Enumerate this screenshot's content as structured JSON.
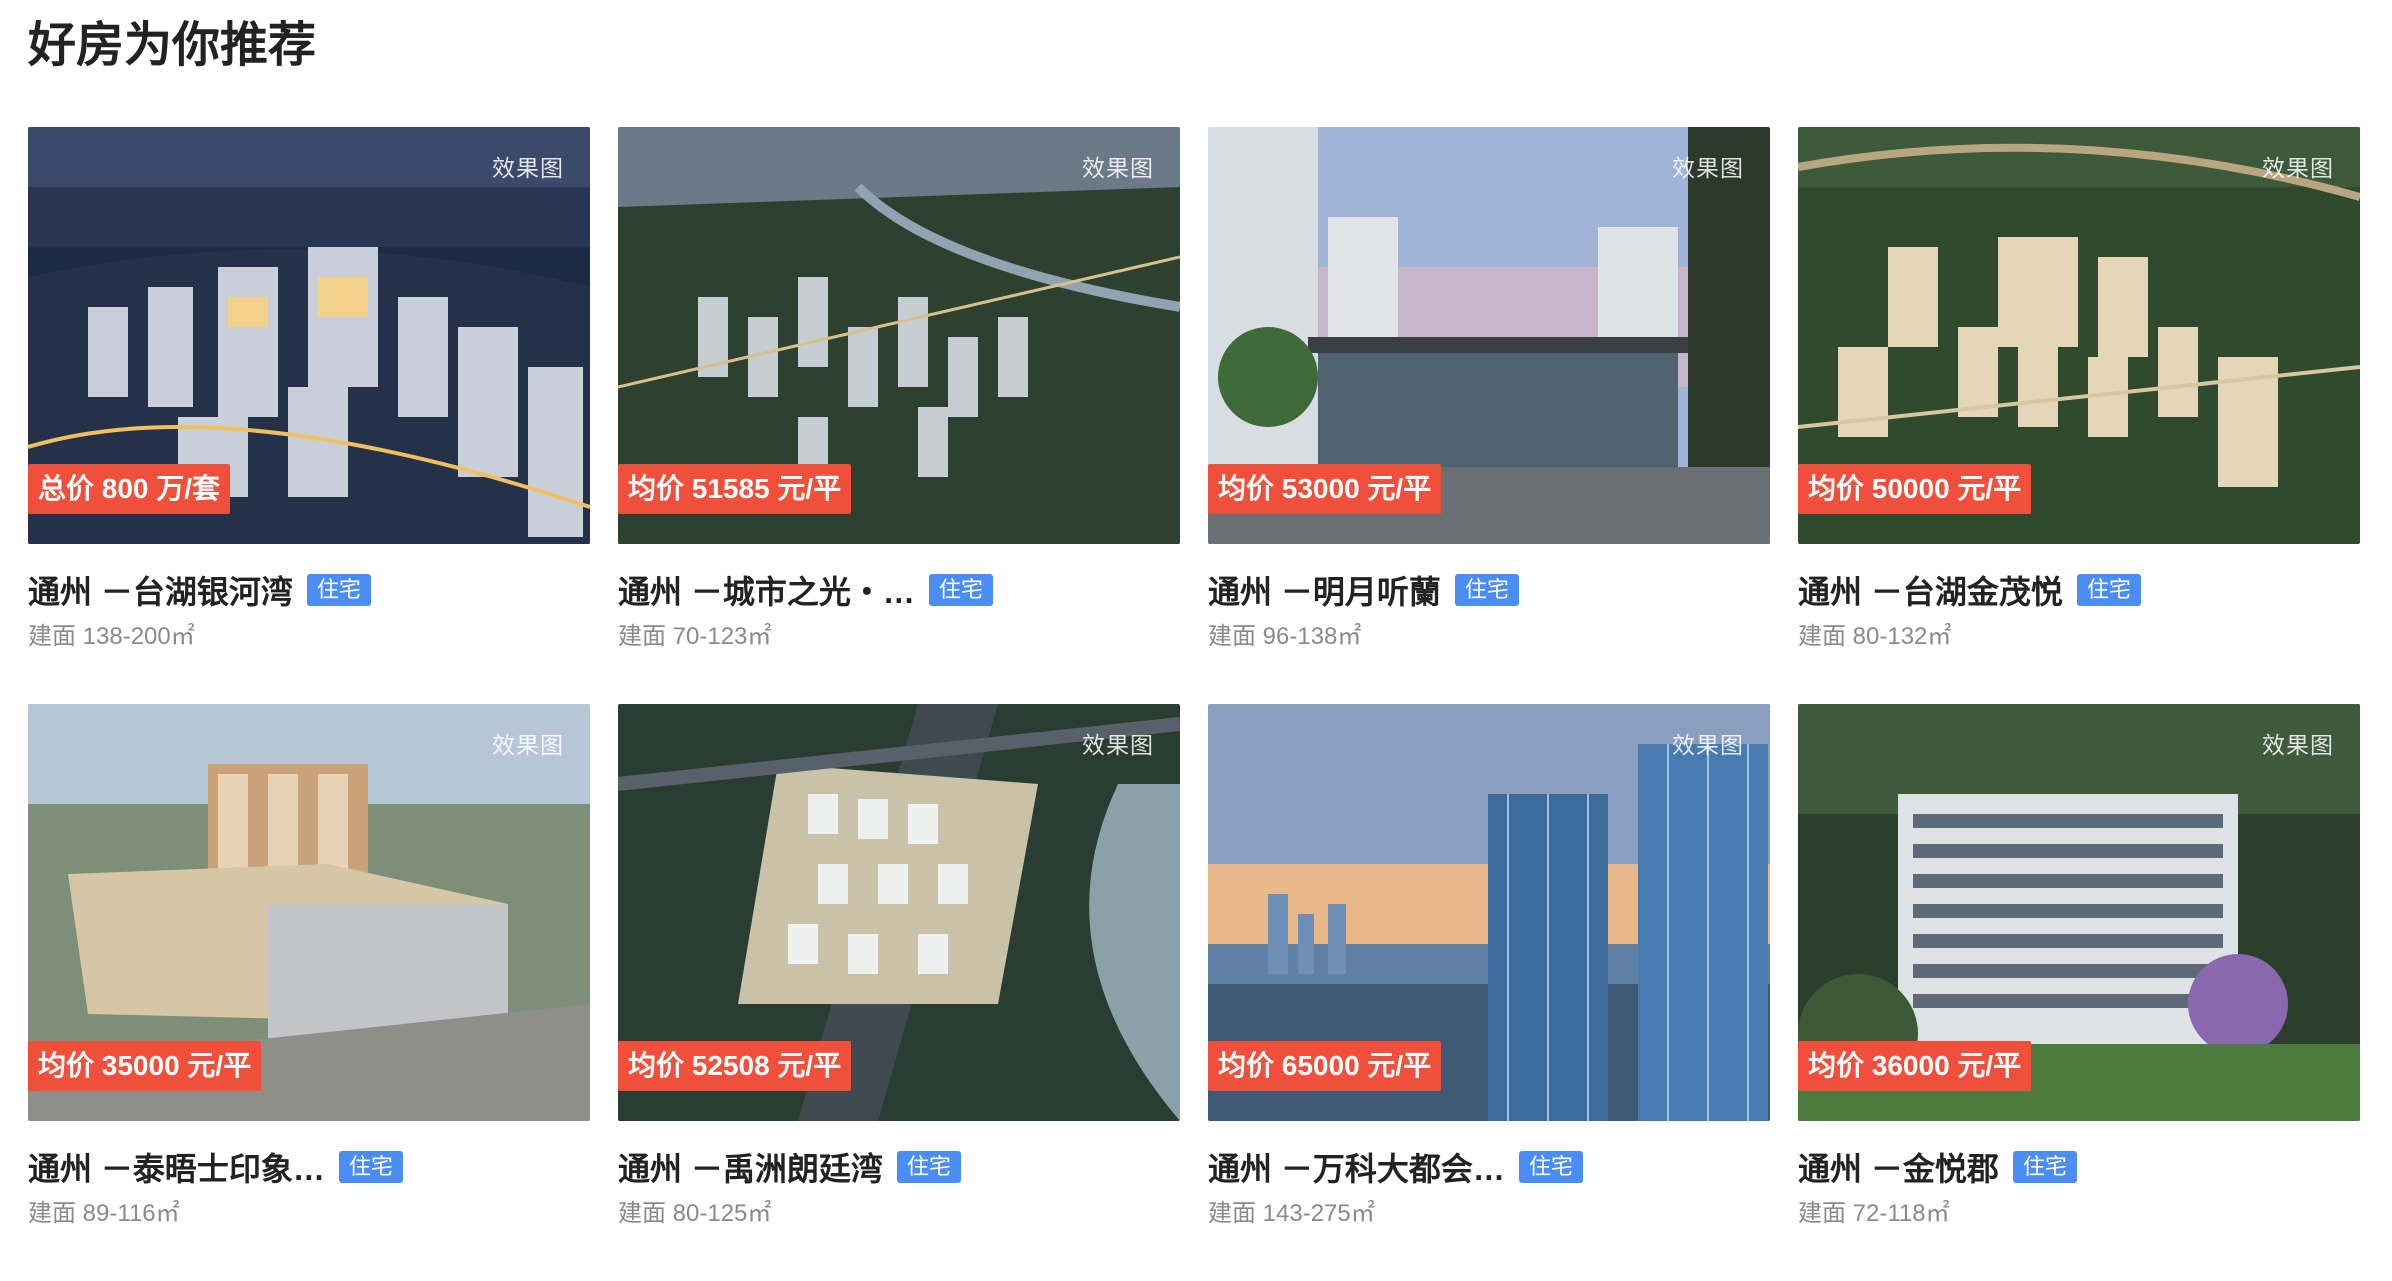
{
  "section": {
    "title": "好房为你推荐"
  },
  "listings": [
    {
      "name": "通州 －台湖银河湾",
      "type": "住宅",
      "area": "建面 138-200㎡",
      "price": "总价 800 万/套",
      "watermark": "效果图",
      "theme": "night-city"
    },
    {
      "name": "通州 －城市之光・…",
      "type": "住宅",
      "area": "建面 70-123㎡",
      "price": "均价 51585 元/平",
      "watermark": "效果图",
      "theme": "aerial-dusk"
    },
    {
      "name": "通州 －明月听蘭",
      "type": "住宅",
      "area": "建面 96-138㎡",
      "price": "均价 53000 元/平",
      "watermark": "效果图",
      "theme": "entrance-sky"
    },
    {
      "name": "通州 －台湖金茂悦",
      "type": "住宅",
      "area": "建面 80-132㎡",
      "price": "均价 50000 元/平",
      "watermark": "效果图",
      "theme": "aerial-green"
    },
    {
      "name": "通州 －泰晤士印象…",
      "type": "住宅",
      "area": "建面 89-116㎡",
      "price": "均价 35000 元/平",
      "watermark": "效果图",
      "theme": "tower-day"
    },
    {
      "name": "通州 －禹洲朗廷湾",
      "type": "住宅",
      "area": "建面 80-125㎡",
      "price": "均价 52508 元/平",
      "watermark": "效果图",
      "theme": "aerial-river"
    },
    {
      "name": "通州 －万科大都会…",
      "type": "住宅",
      "area": "建面 143-275㎡",
      "price": "均价 65000 元/平",
      "watermark": "效果图",
      "theme": "glass-towers"
    },
    {
      "name": "通州 －金悦郡",
      "type": "住宅",
      "area": "建面 72-118㎡",
      "price": "均价 36000 元/平",
      "watermark": "效果图",
      "theme": "building-garden"
    }
  ]
}
